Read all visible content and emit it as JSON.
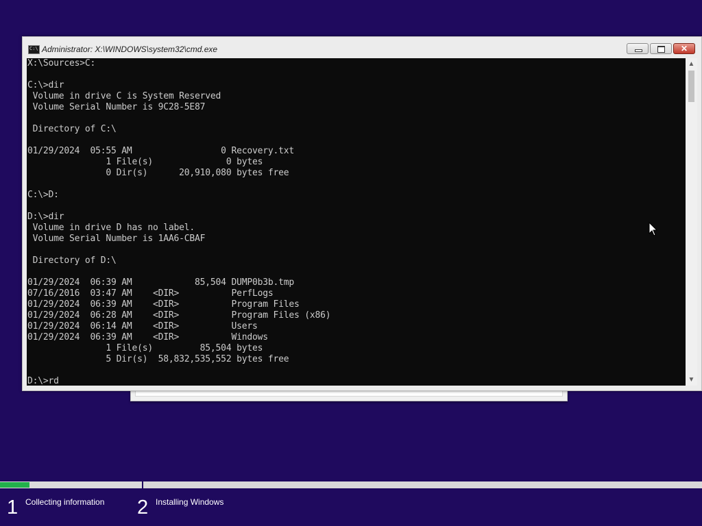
{
  "window": {
    "title": "Administrator: X:\\WINDOWS\\system32\\cmd.exe",
    "icon": "cmd-icon",
    "icon_text": "C:\\"
  },
  "console": {
    "lines": [
      "X:\\Sources>C:",
      "",
      "C:\\>dir",
      " Volume in drive C is System Reserved",
      " Volume Serial Number is 9C28-5E87",
      "",
      " Directory of C:\\",
      "",
      "01/29/2024  05:55 AM                 0 Recovery.txt",
      "               1 File(s)              0 bytes",
      "               0 Dir(s)      20,910,080 bytes free",
      "",
      "C:\\>D:",
      "",
      "D:\\>dir",
      " Volume in drive D has no label.",
      " Volume Serial Number is 1AA6-CBAF",
      "",
      " Directory of D:\\",
      "",
      "01/29/2024  06:39 AM            85,504 DUMP0b3b.tmp",
      "07/16/2016  03:47 AM    <DIR>          PerfLogs",
      "01/29/2024  06:39 AM    <DIR>          Program Files",
      "01/29/2024  06:28 AM    <DIR>          Program Files (x86)",
      "01/29/2024  06:14 AM    <DIR>          Users",
      "01/29/2024  06:39 AM    <DIR>          Windows",
      "               1 File(s)         85,504 bytes",
      "               5 Dir(s)  58,832,535,552 bytes free",
      "",
      "D:\\>rd"
    ]
  },
  "setup": {
    "progress_fraction": 0.21,
    "steps": [
      {
        "number": "1",
        "label": "Collecting information"
      },
      {
        "number": "2",
        "label": "Installing Windows"
      }
    ]
  },
  "colors": {
    "background": "#1f0a5e",
    "progress": "#22b14c",
    "console_bg": "#0c0c0c",
    "console_text": "#cccccc"
  }
}
